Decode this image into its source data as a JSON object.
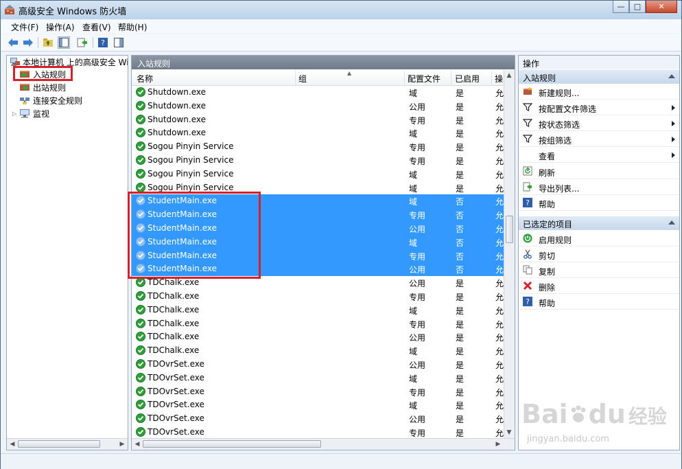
{
  "window": {
    "title": "高级安全 Windows 防火墙",
    "buttons": {
      "minimize": "—",
      "maximize": "□",
      "close": "✕"
    }
  },
  "menu": [
    "文件(F)",
    "操作(A)",
    "查看(V)",
    "帮助(H)"
  ],
  "tree": {
    "root": "本地计算机 上的高级安全 Win",
    "items": [
      "入站规则",
      "出站规则",
      "连接安全规则",
      "监视"
    ]
  },
  "center": {
    "header": "入站规则",
    "columns": [
      "名称",
      "组",
      "配置文件",
      "已启用",
      "操"
    ],
    "rows": [
      {
        "name": "Shutdown.exe",
        "profile": "域",
        "enabled": "是",
        "action": "允",
        "selected": false
      },
      {
        "name": "Shutdown.exe",
        "profile": "公用",
        "enabled": "是",
        "action": "允",
        "selected": false
      },
      {
        "name": "Shutdown.exe",
        "profile": "专用",
        "enabled": "是",
        "action": "允",
        "selected": false
      },
      {
        "name": "Shutdown.exe",
        "profile": "域",
        "enabled": "是",
        "action": "允",
        "selected": false
      },
      {
        "name": "Sogou Pinyin Service",
        "profile": "专用",
        "enabled": "是",
        "action": "允",
        "selected": false
      },
      {
        "name": "Sogou Pinyin Service",
        "profile": "专用",
        "enabled": "是",
        "action": "允",
        "selected": false
      },
      {
        "name": "Sogou Pinyin Service",
        "profile": "域",
        "enabled": "是",
        "action": "允",
        "selected": false
      },
      {
        "name": "Sogou Pinyin Service",
        "profile": "域",
        "enabled": "是",
        "action": "允",
        "selected": false
      },
      {
        "name": "StudentMain.exe",
        "profile": "域",
        "enabled": "否",
        "action": "允",
        "selected": true
      },
      {
        "name": "StudentMain.exe",
        "profile": "专用",
        "enabled": "否",
        "action": "允",
        "selected": true
      },
      {
        "name": "StudentMain.exe",
        "profile": "公用",
        "enabled": "否",
        "action": "允",
        "selected": true
      },
      {
        "name": "StudentMain.exe",
        "profile": "域",
        "enabled": "否",
        "action": "允",
        "selected": true
      },
      {
        "name": "StudentMain.exe",
        "profile": "专用",
        "enabled": "否",
        "action": "允",
        "selected": true
      },
      {
        "name": "StudentMain.exe",
        "profile": "公用",
        "enabled": "否",
        "action": "允",
        "selected": true
      },
      {
        "name": "TDChalk.exe",
        "profile": "公用",
        "enabled": "是",
        "action": "允",
        "selected": false
      },
      {
        "name": "TDChalk.exe",
        "profile": "专用",
        "enabled": "是",
        "action": "允",
        "selected": false
      },
      {
        "name": "TDChalk.exe",
        "profile": "域",
        "enabled": "是",
        "action": "允",
        "selected": false
      },
      {
        "name": "TDChalk.exe",
        "profile": "专用",
        "enabled": "是",
        "action": "允",
        "selected": false
      },
      {
        "name": "TDChalk.exe",
        "profile": "公用",
        "enabled": "是",
        "action": "允",
        "selected": false
      },
      {
        "name": "TDChalk.exe",
        "profile": "域",
        "enabled": "是",
        "action": "允",
        "selected": false
      },
      {
        "name": "TDOvrSet.exe",
        "profile": "公用",
        "enabled": "是",
        "action": "允",
        "selected": false
      },
      {
        "name": "TDOvrSet.exe",
        "profile": "域",
        "enabled": "是",
        "action": "允",
        "selected": false
      },
      {
        "name": "TDOvrSet.exe",
        "profile": "专用",
        "enabled": "是",
        "action": "允",
        "selected": false
      },
      {
        "name": "TDOvrSet.exe",
        "profile": "域",
        "enabled": "是",
        "action": "允",
        "selected": false
      },
      {
        "name": "TDOvrSet.exe",
        "profile": "公用",
        "enabled": "是",
        "action": "允",
        "selected": false
      },
      {
        "name": "TDOvrSet.exe",
        "profile": "专用",
        "enabled": "是",
        "action": "允",
        "selected": false
      }
    ]
  },
  "actions": {
    "title": "操作",
    "section1": "入站规则",
    "items1": [
      {
        "label": "新建规则...",
        "icon": "new-rule-icon",
        "arrow": false
      },
      {
        "label": "按配置文件筛选",
        "icon": "filter-icon",
        "arrow": true
      },
      {
        "label": "按状态筛选",
        "icon": "filter-icon",
        "arrow": true
      },
      {
        "label": "按组筛选",
        "icon": "filter-icon",
        "arrow": true
      },
      {
        "label": "查看",
        "icon": "",
        "arrow": true
      },
      {
        "label": "刷新",
        "icon": "refresh-icon",
        "arrow": false
      },
      {
        "label": "导出列表...",
        "icon": "export-icon",
        "arrow": false
      },
      {
        "label": "帮助",
        "icon": "help-icon",
        "arrow": false
      }
    ],
    "section2": "已选定的项目",
    "items2": [
      {
        "label": "启用规则",
        "icon": "enable-icon"
      },
      {
        "label": "剪切",
        "icon": "cut-icon"
      },
      {
        "label": "复制",
        "icon": "copy-icon"
      },
      {
        "label": "删除",
        "icon": "delete-icon"
      },
      {
        "label": "帮助",
        "icon": "help-icon"
      }
    ]
  },
  "watermark": {
    "brand": "Bai",
    "brand2": "du",
    "cn": "经验",
    "url": "jingyan.baidu.com"
  },
  "colors": {
    "selection": "#3399ff",
    "highlight_box": "#d8202a",
    "ok_icon": "#2f9e3a"
  }
}
